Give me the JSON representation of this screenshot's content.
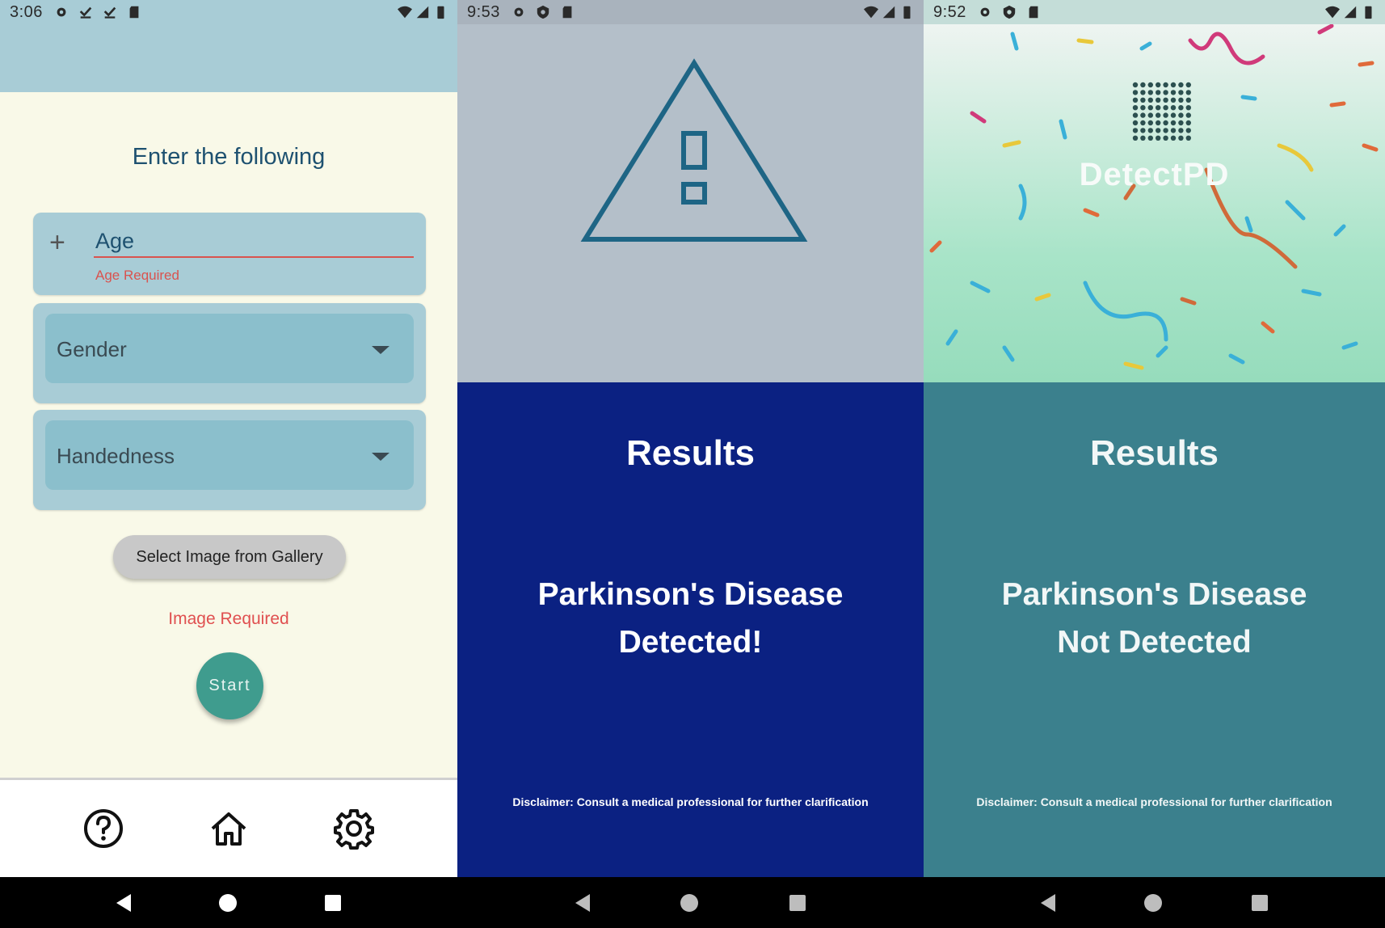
{
  "screen_form": {
    "status_time": "3:06",
    "heading": "Enter the following",
    "age_field": {
      "value": "Age",
      "error": "Age Required"
    },
    "gender_select": {
      "label": "Gender"
    },
    "handedness_select": {
      "label": "Handedness"
    },
    "gallery_button": "Select Image from Gallery",
    "image_error": "Image Required",
    "start_button": "Start",
    "bottom_nav": [
      "help-icon",
      "home-icon",
      "settings-icon"
    ]
  },
  "screen_detected": {
    "status_time": "9:53",
    "title": "Results",
    "message_line1": "Parkinson's Disease",
    "message_line2": "Detected!",
    "disclaimer": "Disclaimer: Consult a medical professional for further clarification",
    "icon": "warning-triangle-icon"
  },
  "screen_not_detected": {
    "status_time": "9:52",
    "logo_text": "DetectPD",
    "title": "Results",
    "message_line1": "Parkinson's Disease",
    "message_line2": "Not Detected",
    "disclaimer": "Disclaimer: Consult a medical professional for further clarification"
  },
  "colors": {
    "form_bg": "#f9f9e8",
    "card": "#a8ccd6",
    "error": "#d9534f",
    "start_button": "#3f9c8e",
    "detected_bg": "#0b2182",
    "not_detected_bg": "#3b808d"
  }
}
